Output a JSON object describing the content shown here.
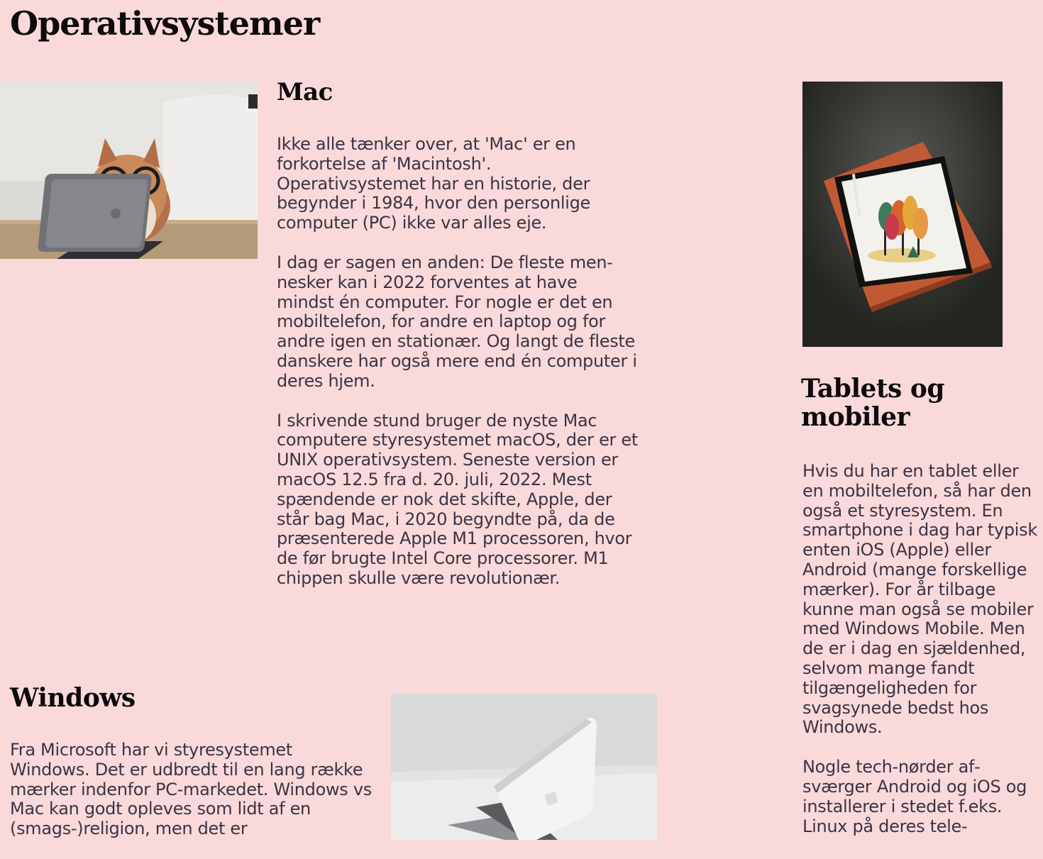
{
  "page": {
    "title": "Operativsystemer"
  },
  "mac": {
    "heading": "Mac",
    "paragraphs": [
      "Ikke alle tænker over, at 'Mac' er en forkortelse af 'Macintosh'. Operativsystemet har en historie, der begynder i 1984, hvor den personlige computer (PC) ikke var alles eje.",
      "I dag er sagen en anden: De fleste men­nesker kan i 2022 forventes at have mindst én computer. For nogle er det en mobiltelefon, for andre en laptop og for andre igen en stationær. Og langt de fle­ste danskere har også mere end én com­puter i deres hjem.",
      "I skrivende stund bruger de nyste Mac computere styresystemet macOS, der er et UNIX operativsystem. Seneste ver­sion er macOS 12.5 fra d. 20. juli, 2022. Mest spændende er nok det skifte, Apple, der står bag Mac, i 2020 begynd­te på, da de præsenterede Apple M1 processoren, hvor de før brugte Intel Core processorer. M1 chippen skulle være revolutionær."
    ]
  },
  "windows": {
    "heading": "Windows",
    "paragraphs": [
      "Fra Microsoft har vi styresystemet Windows. Det er udbredt til en lang række mærker indenfor PC-markedet. Windows vs Mac kan godt opleves som lidt af en (smags-)religion, men det er"
    ]
  },
  "tablets": {
    "heading": "Tablets og mobiler",
    "paragraphs": [
      "Hvis du har en tablet eller en mobiltelefon, så har den også et styresystem. En smartphone i dag har typisk enten iOS (Apple) eller Android (mange for­skellige mærker). For år tilbage kunne man også se mobiler med Windows Mobile. Men de er i dag en sjældenhed, selvom man­ge fandt tilgængeligheden for svagsynede bedst hos Windows.",
      "Nogle tech-nørder af­sværger Android og iOS og installerer i stedet f.eks. Linux på deres tele-"
    ]
  },
  "colors": {
    "background": "#f9d9d9",
    "heading": "#0d0a0d",
    "body_text": "#3b3446"
  }
}
